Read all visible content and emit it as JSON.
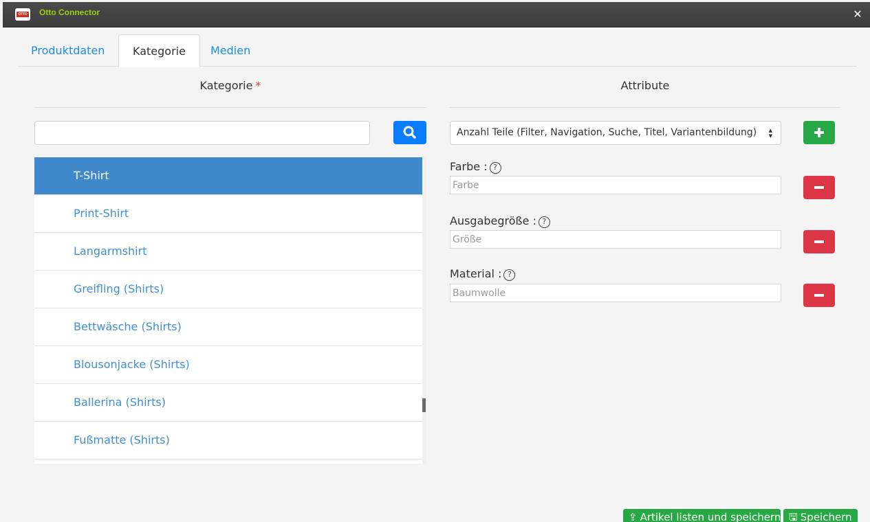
{
  "window": {
    "title": "Otto Connector",
    "logo_text": "OTTO"
  },
  "tabs": [
    {
      "label": "Produktdaten"
    },
    {
      "label": "Kategorie",
      "active": true
    },
    {
      "label": "Medien"
    }
  ],
  "kategorie": {
    "section_title": "Kategorie",
    "required_mark": "*",
    "search": {
      "value": "",
      "placeholder": ""
    },
    "items": [
      {
        "label": "T-Shirt",
        "selected": true
      },
      {
        "label": "Print-Shirt"
      },
      {
        "label": "Langarmshirt"
      },
      {
        "label": "Greifling (Shirts)"
      },
      {
        "label": "Bettwäsche (Shirts)"
      },
      {
        "label": "Blousonjacke (Shirts)"
      },
      {
        "label": "Ballerina (Shirts)"
      },
      {
        "label": "Fußmatte (Shirts)"
      }
    ]
  },
  "attribute": {
    "section_title": "Attribute",
    "selected_attribute": "Anzahl Teile (Filter, Navigation, Suche, Titel, Variantenbildung)",
    "fields": [
      {
        "label": "Farbe :",
        "placeholder": "Farbe"
      },
      {
        "label": "Ausgabegröße :",
        "placeholder": "Größe"
      },
      {
        "label": "Material :",
        "placeholder": "Baumwolle"
      }
    ]
  },
  "footer": {
    "list_and_save_label": "Artikel listen und speichern",
    "save_label": "Speichern"
  },
  "colors": {
    "title_text": "#9bd10e",
    "tab_link": "#1a8de6",
    "selected_item": "#3f88c9",
    "search_button": "#0a7cff",
    "add_button": "#28a745",
    "remove_button": "#dc3545"
  }
}
